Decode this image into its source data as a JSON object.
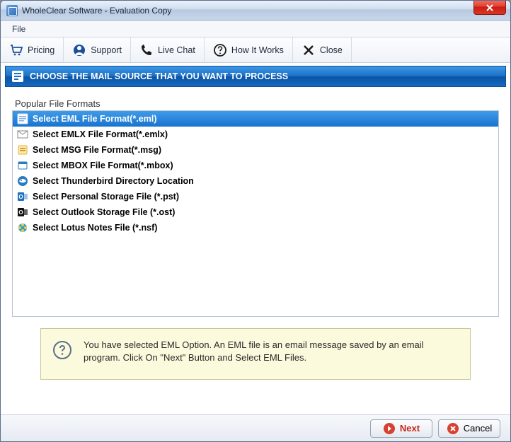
{
  "window": {
    "title": "WholeClear Software - Evaluation Copy"
  },
  "menubar": {
    "file": "File"
  },
  "toolbar": {
    "pricing": "Pricing",
    "support": "Support",
    "livechat": "Live Chat",
    "howitworks": "How It Works",
    "close": "Close"
  },
  "banner": {
    "text": "CHOOSE THE MAIL SOURCE THAT YOU WANT TO PROCESS"
  },
  "group": {
    "label": "Popular File Formats"
  },
  "formats": [
    {
      "label": "Select EML File Format(*.eml)",
      "selected": true
    },
    {
      "label": "Select EMLX File Format(*.emlx)",
      "selected": false
    },
    {
      "label": "Select MSG File Format(*.msg)",
      "selected": false
    },
    {
      "label": "Select MBOX File Format(*.mbox)",
      "selected": false
    },
    {
      "label": "Select Thunderbird Directory Location",
      "selected": false
    },
    {
      "label": "Select Personal Storage File (*.pst)",
      "selected": false
    },
    {
      "label": "Select Outlook Storage File (*.ost)",
      "selected": false
    },
    {
      "label": "Select Lotus Notes File (*.nsf)",
      "selected": false
    }
  ],
  "info": {
    "text": "You have selected EML Option. An EML file is an email message saved by an email program. Click On \"Next\" Button and Select EML Files."
  },
  "footer": {
    "next": "Next",
    "cancel": "Cancel"
  }
}
